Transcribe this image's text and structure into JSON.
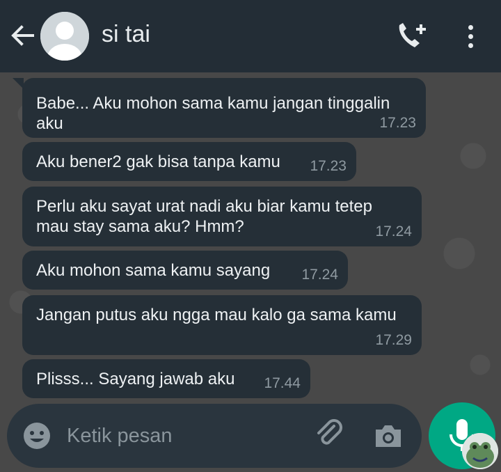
{
  "header": {
    "contact_name": "si tai",
    "icons": {
      "back": "arrow-back-icon",
      "avatar": "default-avatar-icon",
      "call": "add-call-icon",
      "menu": "more-vertical-icon"
    }
  },
  "messages": [
    {
      "text": "Babe... Aku mohon sama kamu jangan tinggalin aku",
      "time": "17.23"
    },
    {
      "text": "Aku bener2 gak bisa tanpa kamu",
      "time": "17.23"
    },
    {
      "text": "Perlu aku sayat urat nadi aku biar kamu tetep mau stay sama aku? Hmm?",
      "time": "17.24"
    },
    {
      "text": "Aku mohon sama kamu sayang",
      "time": "17.24"
    },
    {
      "text": "Jangan putus aku ngga mau kalo ga sama kamu",
      "time": "17.29"
    },
    {
      "text": "Plisss... Sayang jawab aku",
      "time": "17.44"
    }
  ],
  "composer": {
    "placeholder": "Ketik pesan",
    "icons": {
      "emoji": "emoji-icon",
      "attach": "paperclip-icon",
      "camera": "camera-icon",
      "mic": "microphone-icon"
    }
  },
  "colors": {
    "header_bg": "#232d36",
    "bubble_bg": "#252f37",
    "accent": "#00a884",
    "chat_bg": "#484848"
  }
}
